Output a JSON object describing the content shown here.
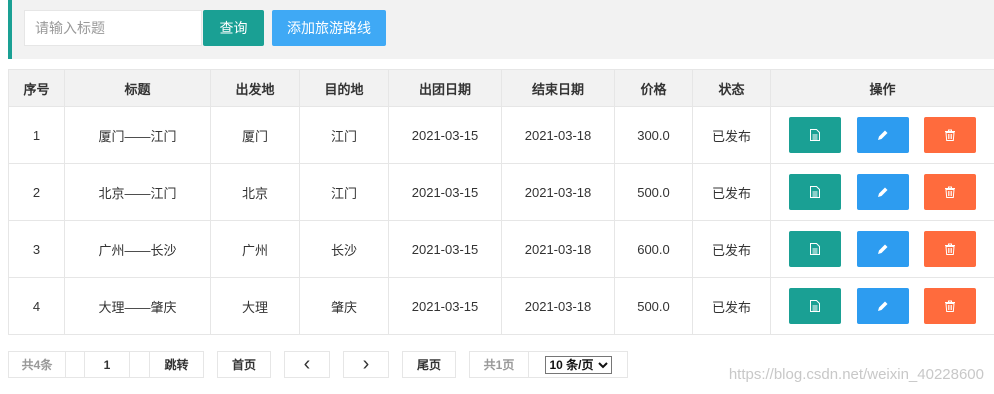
{
  "search": {
    "placeholder": "请输入标题",
    "value": ""
  },
  "toolbar": {
    "query_label": "查询",
    "add_label": "添加旅游路线"
  },
  "colors": {
    "teal": "#1aa094",
    "blue": "#2d9cf0",
    "orange": "#ff6b3d",
    "header_bg": "#f2f2f2"
  },
  "table": {
    "headers": [
      "序号",
      "标题",
      "出发地",
      "目的地",
      "出团日期",
      "结束日期",
      "价格",
      "状态",
      "操作"
    ],
    "rows": [
      {
        "id": "1",
        "title": "厦门——江门",
        "from": "厦门",
        "to": "江门",
        "start": "2021-03-15",
        "end": "2021-03-18",
        "price": "300.0",
        "status": "已发布"
      },
      {
        "id": "2",
        "title": "北京——江门",
        "from": "北京",
        "to": "江门",
        "start": "2021-03-15",
        "end": "2021-03-18",
        "price": "500.0",
        "status": "已发布"
      },
      {
        "id": "3",
        "title": "广州——长沙",
        "from": "广州",
        "to": "长沙",
        "start": "2021-03-15",
        "end": "2021-03-18",
        "price": "600.0",
        "status": "已发布"
      },
      {
        "id": "4",
        "title": "大理——肇庆",
        "from": "大理",
        "to": "肇庆",
        "start": "2021-03-15",
        "end": "2021-03-18",
        "price": "500.0",
        "status": "已发布"
      }
    ],
    "row_icons": [
      "document-icon",
      "pencil-icon",
      "trash-icon"
    ]
  },
  "pager": {
    "total": "共4条",
    "page_value": "1",
    "jump": "跳转",
    "first": "首页",
    "prev": "‹",
    "next": "›",
    "last": "尾页",
    "pages": "共1页",
    "page_size": "10 条/页"
  },
  "watermark": "https://blog.csdn.net/weixin_40228600"
}
